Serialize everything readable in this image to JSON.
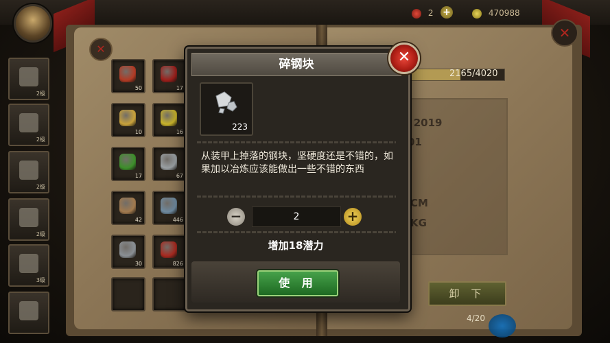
{
  "top": {
    "resource_1": "2",
    "resource_2": "470988"
  },
  "left_page": {
    "categories": [
      {
        "level": "2级"
      },
      {
        "level": "2级"
      },
      {
        "level": "2级"
      },
      {
        "level": "2级"
      },
      {
        "level": "3级"
      },
      {
        "level": ""
      }
    ],
    "slots": [
      {
        "count": "50",
        "color": "#b23a24"
      },
      {
        "count": "17",
        "color": "#9e1f1b"
      },
      {
        "count": "10",
        "color": "#c9a23b"
      },
      {
        "count": "16",
        "color": "#c9b32a"
      },
      {
        "count": "17",
        "color": "#3d8f2a"
      },
      {
        "count": "67",
        "color": "#9aa0a3"
      },
      {
        "count": "42",
        "color": "#a27a4e"
      },
      {
        "count": "446",
        "color": "#6e8aa0"
      },
      {
        "count": "30",
        "color": "#8a8f94"
      },
      {
        "count": "826",
        "color": "#a8291f"
      },
      {
        "count": "",
        "color": ""
      },
      {
        "count": "",
        "color": ""
      }
    ]
  },
  "right_page": {
    "progress_text": "2165/4020",
    "progress_fraction": 0.54,
    "lines": [
      "/ 2019",
      "01",
      "CM",
      "KG"
    ],
    "unload_label": "卸 下",
    "page_indicator": "4/20"
  },
  "modal": {
    "title": "碎钢块",
    "item_quantity": "223",
    "description": "从装甲上掉落的钢块，坚硬度还是不错的，如果加以冶炼应该能做出一些不错的东西",
    "stepper_value": "2",
    "potential_text": "增加18潜力",
    "use_label": "使 用",
    "close_icon": "close-x-icon"
  }
}
